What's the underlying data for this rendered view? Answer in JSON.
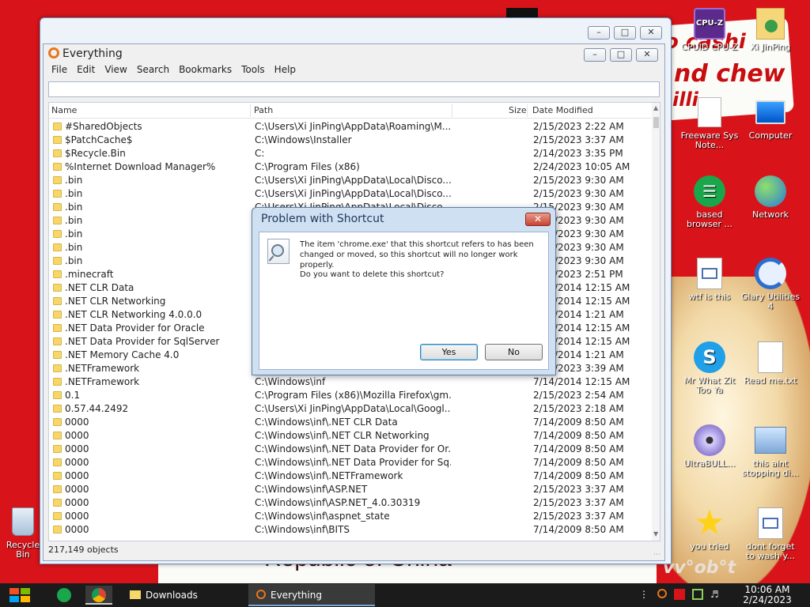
{
  "desktop": {
    "wallpaper_text_top": "o cashi",
    "wallpaper_text_mid": "nd chew",
    "wallpaper_text_small": "illi",
    "wallpaper_bottom": "Republic of China",
    "wallpaper_corner": "vv°ob°t",
    "icons": [
      {
        "label": "CPUID CPU-Z",
        "icon": "cpuz-icon"
      },
      {
        "label": "Xi JinPing",
        "icon": "user-folder-icon"
      },
      {
        "label": "Freeware Sys Note...",
        "icon": "document-icon"
      },
      {
        "label": "Computer",
        "icon": "computer-icon"
      },
      {
        "label": "based browser ...",
        "icon": "browser-icon"
      },
      {
        "label": "Network",
        "icon": "network-icon"
      },
      {
        "label": "wtf is this",
        "icon": "html-file-icon"
      },
      {
        "label": "Glary Utilities 4",
        "icon": "glary-icon"
      },
      {
        "label": "Mr What Zit Too Ya",
        "icon": "skype-icon"
      },
      {
        "label": "Read me.txt",
        "icon": "text-file-icon"
      },
      {
        "label": "UltraBULL...",
        "icon": "disc-icon"
      },
      {
        "label": "this aint stopping di...",
        "icon": "installer-icon"
      },
      {
        "label": "you tried",
        "icon": "star-icon"
      },
      {
        "label": "dont forget to wash y...",
        "icon": "html-file-icon"
      },
      {
        "label": "Recycle Bin",
        "icon": "recycle-bin-icon"
      }
    ]
  },
  "window": {
    "title": "Everything",
    "menu": [
      "File",
      "Edit",
      "View",
      "Search",
      "Bookmarks",
      "Tools",
      "Help"
    ],
    "search_value": "",
    "columns": {
      "name": "Name",
      "path": "Path",
      "size": "Size",
      "date": "Date Modified"
    },
    "status": "217,149 objects",
    "rows": [
      {
        "name": "#SharedObjects",
        "path": "C:\\Users\\Xi JinPing\\AppData\\Roaming\\M...",
        "date": "2/15/2023 2:22 AM"
      },
      {
        "name": "$PatchCache$",
        "path": "C:\\Windows\\Installer",
        "date": "2/15/2023 3:37 AM"
      },
      {
        "name": "$Recycle.Bin",
        "path": "C:",
        "date": "2/14/2023 3:35 PM"
      },
      {
        "name": "%Internet Download Manager%",
        "path": "C:\\Program Files (x86)",
        "date": "2/24/2023 10:05 AM"
      },
      {
        "name": ".bin",
        "path": "C:\\Users\\Xi JinPing\\AppData\\Local\\Disco...",
        "date": "2/15/2023 9:30 AM"
      },
      {
        "name": ".bin",
        "path": "C:\\Users\\Xi JinPing\\AppData\\Local\\Disco...",
        "date": "2/15/2023 9:30 AM"
      },
      {
        "name": ".bin",
        "path": "C:\\Users\\Xi JinPing\\AppData\\Local\\Disco...",
        "date": "2/15/2023 9:30 AM"
      },
      {
        "name": ".bin",
        "path": "",
        "date": "2/15/2023 9:30 AM"
      },
      {
        "name": ".bin",
        "path": "",
        "date": "2/15/2023 9:30 AM"
      },
      {
        "name": ".bin",
        "path": "",
        "date": "2/15/2023 9:30 AM"
      },
      {
        "name": ".bin",
        "path": "",
        "date": "2/15/2023 9:30 AM"
      },
      {
        "name": ".minecraft",
        "path": "",
        "date": "2/15/2023 2:51 PM"
      },
      {
        "name": ".NET CLR Data",
        "path": "",
        "date": "7/14/2014 12:15 AM"
      },
      {
        "name": ".NET CLR Networking",
        "path": "",
        "date": "7/14/2014 12:15 AM"
      },
      {
        "name": ".NET CLR Networking 4.0.0.0",
        "path": "",
        "date": "2/15/2014 1:21 AM"
      },
      {
        "name": ".NET Data Provider for Oracle",
        "path": "",
        "date": "7/14/2014 12:15 AM"
      },
      {
        "name": ".NET Data Provider for SqlServer",
        "path": "",
        "date": "7/14/2014 12:15 AM"
      },
      {
        "name": ".NET Memory Cache 4.0",
        "path": "",
        "date": "2/15/2014 1:21 AM"
      },
      {
        "name": ".NETFramework",
        "path": "",
        "date": "2/15/2023 3:39 AM"
      },
      {
        "name": ".NETFramework",
        "path": "C:\\Windows\\inf",
        "date": "7/14/2014 12:15 AM"
      },
      {
        "name": "0.1",
        "path": "C:\\Program Files (x86)\\Mozilla Firefox\\gm...",
        "date": "2/15/2023 2:54 AM"
      },
      {
        "name": "0.57.44.2492",
        "path": "C:\\Users\\Xi JinPing\\AppData\\Local\\Googl...",
        "date": "2/15/2023 2:18 AM"
      },
      {
        "name": "0000",
        "path": "C:\\Windows\\inf\\.NET CLR Data",
        "date": "7/14/2009 8:50 AM"
      },
      {
        "name": "0000",
        "path": "C:\\Windows\\inf\\.NET CLR Networking",
        "date": "7/14/2009 8:50 AM"
      },
      {
        "name": "0000",
        "path": "C:\\Windows\\inf\\.NET Data Provider for Or...",
        "date": "7/14/2009 8:50 AM"
      },
      {
        "name": "0000",
        "path": "C:\\Windows\\inf\\.NET Data Provider for Sq...",
        "date": "7/14/2009 8:50 AM"
      },
      {
        "name": "0000",
        "path": "C:\\Windows\\inf\\.NETFramework",
        "date": "7/14/2009 8:50 AM"
      },
      {
        "name": "0000",
        "path": "C:\\Windows\\inf\\ASP.NET",
        "date": "2/15/2023 3:37 AM"
      },
      {
        "name": "0000",
        "path": "C:\\Windows\\inf\\ASP.NET_4.0.30319",
        "date": "2/15/2023 3:37 AM"
      },
      {
        "name": "0000",
        "path": "C:\\Windows\\inf\\aspnet_state",
        "date": "2/15/2023 3:37 AM"
      },
      {
        "name": "0000",
        "path": "C:\\Windows\\inf\\BITS",
        "date": "7/14/2009 8:50 AM"
      }
    ]
  },
  "dialog": {
    "title": "Problem with Shortcut",
    "close": "✕",
    "message": "The item 'chrome.exe' that this shortcut refers to has been changed or moved, so this shortcut will no longer work properly.",
    "question": "Do you want to delete this shortcut?",
    "yes": "Yes",
    "no": "No"
  },
  "taskbar": {
    "downloads": "Downloads",
    "everything": "Everything",
    "time": "10:06 AM",
    "date": "2/24/2023"
  },
  "colors": {
    "accent": "#e8761a",
    "wallpaper": "#d8141a",
    "taskbar": "#1b1b1b"
  }
}
